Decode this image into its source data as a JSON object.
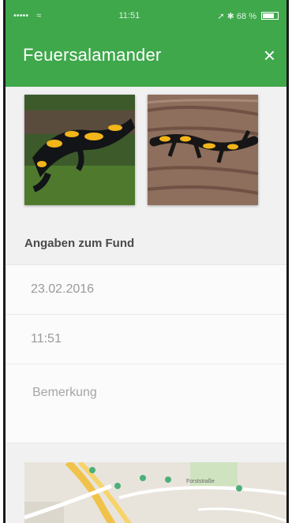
{
  "statusbar": {
    "signal": "•••••",
    "carrier": "≈",
    "time": "11:51",
    "indicators": "➚ ✱ 68 %"
  },
  "appbar": {
    "title": "Feuersalamander",
    "close_icon": "×",
    "color": "#3fa84b"
  },
  "section": {
    "heading": "Angaben zum Fund"
  },
  "form": {
    "date": "23.02.2016",
    "time": "11:51",
    "remark_placeholder": "Bemerkung"
  },
  "map": {
    "street_label": "Forststraße"
  }
}
